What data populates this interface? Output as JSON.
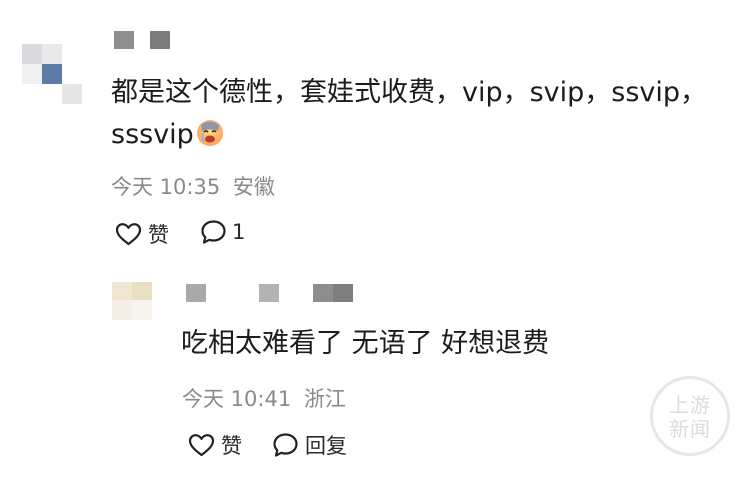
{
  "comment": {
    "text_line1": "都是这个德性，套娃式收费，vip，svip，ssvip，",
    "text_line2": "sssvip",
    "emoji": "sad-crying-emoji",
    "time": "今天 10:35",
    "location": "安徽",
    "like_label": "赞",
    "reply_count": "1"
  },
  "reply": {
    "text": "吃相太难看了 无语了 好想退费",
    "time": "今天 10:41",
    "location": "浙江",
    "like_label": "赞",
    "reply_label": "回复"
  },
  "watermark": {
    "line1": "上游",
    "line2": "新闻"
  },
  "colors": {
    "text": "#1c1c1c",
    "meta": "#8a8a8a",
    "watermark": "#dcdcdc"
  }
}
